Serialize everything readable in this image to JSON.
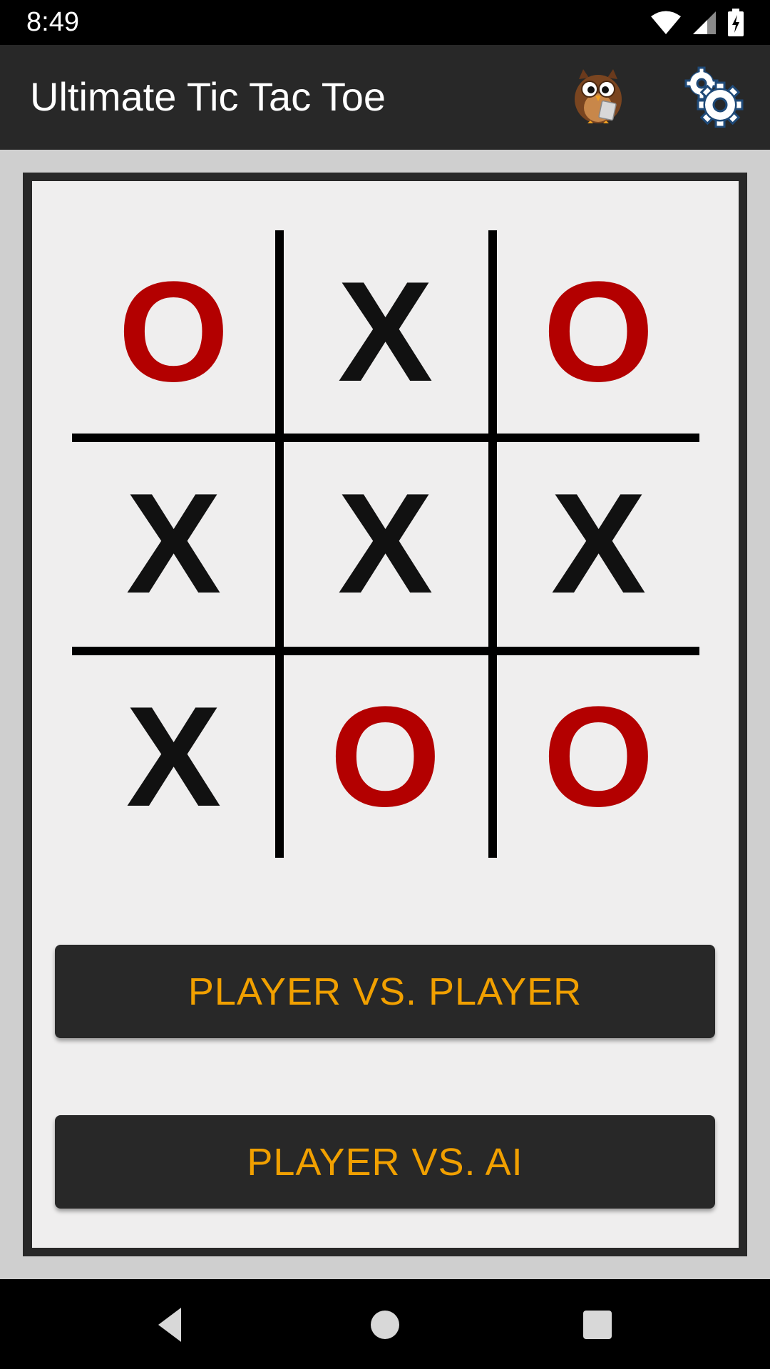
{
  "status_bar": {
    "time": "8:49",
    "icons": [
      "wifi-icon",
      "signal-icon",
      "battery-charging-icon"
    ]
  },
  "app_bar": {
    "title": "Ultimate Tic Tac Toe",
    "actions": [
      "owl-mascot-icon",
      "settings-gear-icon"
    ]
  },
  "board": {
    "cells": [
      [
        "O",
        "X",
        "O"
      ],
      [
        "X",
        "X",
        "X"
      ],
      [
        "X",
        "O",
        "O"
      ]
    ]
  },
  "buttons": {
    "player_vs_player": "PLAYER VS. PLAYER",
    "player_vs_ai": "PLAYER VS. AI"
  },
  "nav_bar": {
    "icons": [
      "back-icon",
      "home-icon",
      "recents-icon"
    ]
  },
  "colors": {
    "app_bar": "#282828",
    "panel_background": "#efeeee",
    "x_mark": "#111111",
    "o_mark": "#b30000",
    "button_text": "#f1a000",
    "button_background": "#282828"
  }
}
